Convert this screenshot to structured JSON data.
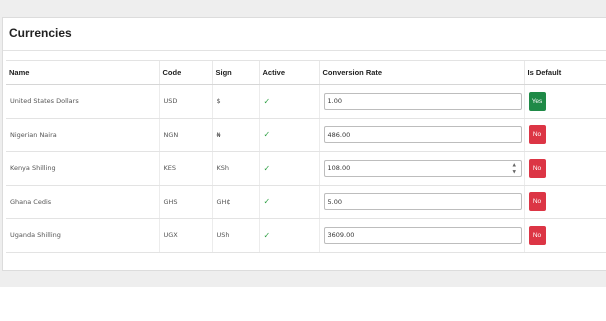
{
  "card": {
    "title": "Currencies"
  },
  "table": {
    "headers": [
      "Name",
      "Code",
      "Sign",
      "Active",
      "Conversion Rate",
      "Is Default"
    ],
    "rows": [
      {
        "name": "United States Dollars",
        "code": "USD",
        "sign": "$",
        "active": "✓",
        "rate": "1.00",
        "default": "Yes",
        "spinner": false
      },
      {
        "name": "Nigerian Naira",
        "code": "NGN",
        "sign": "₦",
        "active": "✓",
        "rate": "486.00",
        "default": "No",
        "spinner": false
      },
      {
        "name": "Kenya Shilling",
        "code": "KES",
        "sign": "KSh",
        "active": "✓",
        "rate": "108.00",
        "default": "No",
        "spinner": true
      },
      {
        "name": "Ghana Cedis",
        "code": "GHS",
        "sign": "GH₵",
        "active": "✓",
        "rate": "5.00",
        "default": "No",
        "spinner": false
      },
      {
        "name": "Uganda Shilling",
        "code": "UGX",
        "sign": "USh",
        "active": "✓",
        "rate": "3609.00",
        "default": "No",
        "spinner": false
      }
    ]
  },
  "colors": {
    "yes": "#1f8a47",
    "no": "#dc3545",
    "check": "#2ea043"
  }
}
